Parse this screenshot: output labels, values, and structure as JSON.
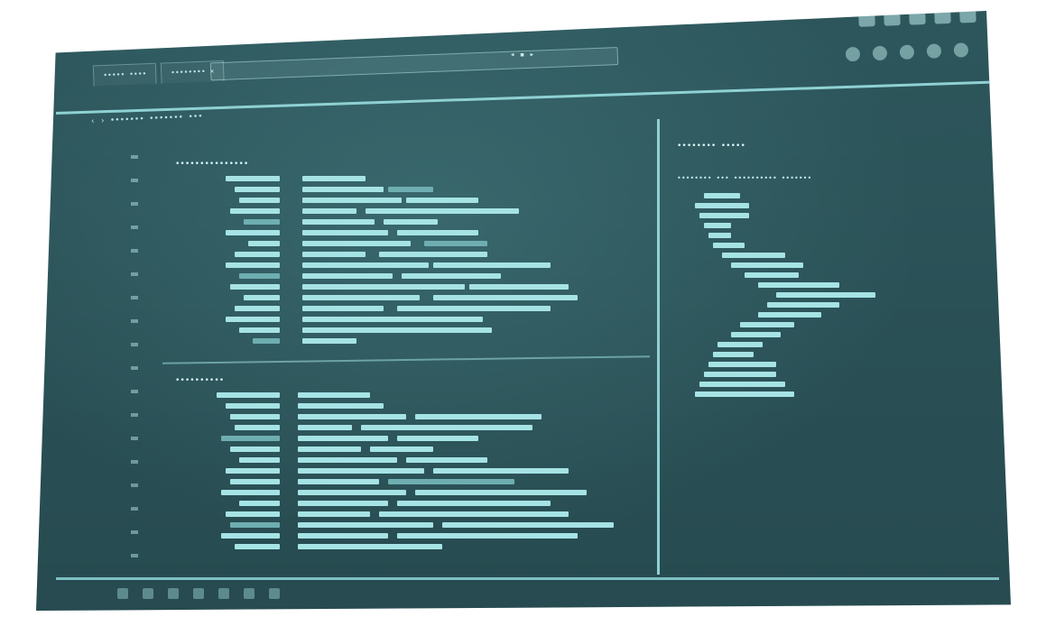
{
  "tabs": [
    {
      "label": "••••• ••••"
    },
    {
      "label": "•••••••• ×"
    }
  ],
  "breadcrumb": "‹  ›  •••••••  ••••••• •••",
  "center_icons": "◂ ▪ ▸",
  "left_pane": {
    "top_title": "•••••••••••••••",
    "bottom_title": "••••••••••"
  },
  "right_pane": {
    "title": "•••••••• •••••",
    "subtitle": "•••••••• ••• •••••••••• •••••••"
  },
  "icons": {
    "window_controls": [
      "minimize-icon",
      "maximize-icon",
      "close-icon",
      "menu-icon",
      "help-icon"
    ],
    "toolbar": [
      "refresh-icon",
      "home-icon",
      "bookmark-icon",
      "download-icon",
      "settings-icon"
    ]
  },
  "colors": {
    "screen": "#2f5b61",
    "text": "#a6e3e5",
    "divider": "#8fd1d3"
  }
}
